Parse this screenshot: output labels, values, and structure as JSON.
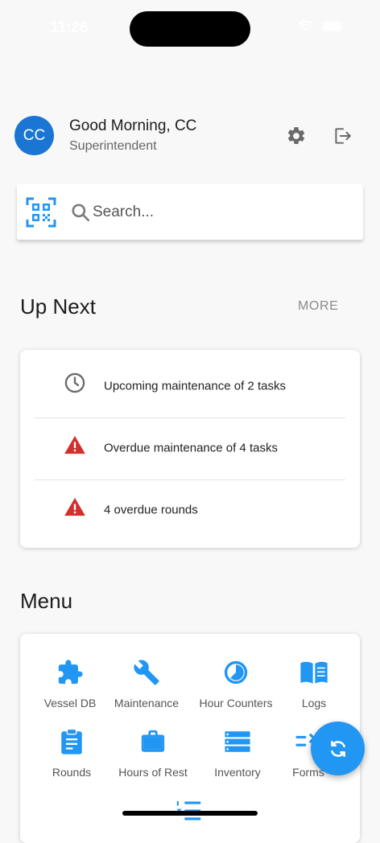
{
  "status_bar": {
    "time": "11:26"
  },
  "header": {
    "avatar_initials": "CC",
    "greeting": "Good Morning, CC",
    "role": "Superintendent",
    "settings_icon": "gear-icon",
    "logout_icon": "logout-icon"
  },
  "search": {
    "placeholder": "Search...",
    "value": ""
  },
  "up_next": {
    "title": "Up Next",
    "more_label": "MORE",
    "items": [
      {
        "icon": "clock-icon",
        "text": "Upcoming maintenance of 2 tasks"
      },
      {
        "icon": "warning-icon",
        "text": "Overdue maintenance of 4 tasks"
      },
      {
        "icon": "warning-icon",
        "text": "4 overdue rounds"
      }
    ]
  },
  "menu": {
    "title": "Menu",
    "items": [
      {
        "label": "Vessel DB",
        "icon": "puzzle-icon"
      },
      {
        "label": "Maintenance",
        "icon": "wrench-icon"
      },
      {
        "label": "Hour Counters",
        "icon": "timer-icon"
      },
      {
        "label": "Logs",
        "icon": "book-icon"
      },
      {
        "label": "Rounds",
        "icon": "clipboard-icon"
      },
      {
        "label": "Hours of Rest",
        "icon": "briefcase-icon"
      },
      {
        "label": "Inventory",
        "icon": "list-icon"
      },
      {
        "label": "Forms",
        "icon": "forms-icon"
      }
    ]
  },
  "colors": {
    "primary": "#1a76d2",
    "accent": "#2196f3",
    "warning": "#d32f2f",
    "background": "#f8f8f8"
  }
}
